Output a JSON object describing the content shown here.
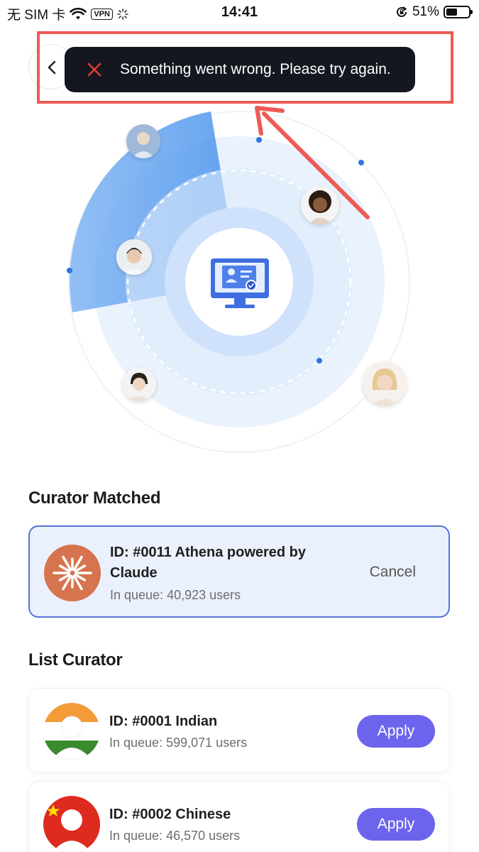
{
  "status_bar": {
    "carrier": "无 SIM 卡",
    "vpn": "VPN",
    "time": "14:41",
    "battery": "51%",
    "battery_level": 0.51
  },
  "toast": {
    "message": "Something went wrong. Please try again."
  },
  "matched": {
    "title": "Curator Matched",
    "card": {
      "title_line1": "ID: #0011 Athena powered by",
      "title_line2": "Claude",
      "queue": "In queue: 40,923 users",
      "cancel_label": "Cancel"
    }
  },
  "list": {
    "title": "List Curator",
    "items": [
      {
        "title": "ID: #0001 Indian",
        "queue": "In queue: 599,071 users",
        "apply_label": "Apply"
      },
      {
        "title": "ID: #0002 Chinese",
        "queue": "In queue: 46,570 users",
        "apply_label": "Apply"
      }
    ]
  },
  "colors": {
    "accent": "#6c64ec",
    "toast_bg": "#14171f",
    "error": "#e53935",
    "highlight": "#ee5a55",
    "matched_bg": "#eaf1fd",
    "matched_border": "#5473d6"
  }
}
